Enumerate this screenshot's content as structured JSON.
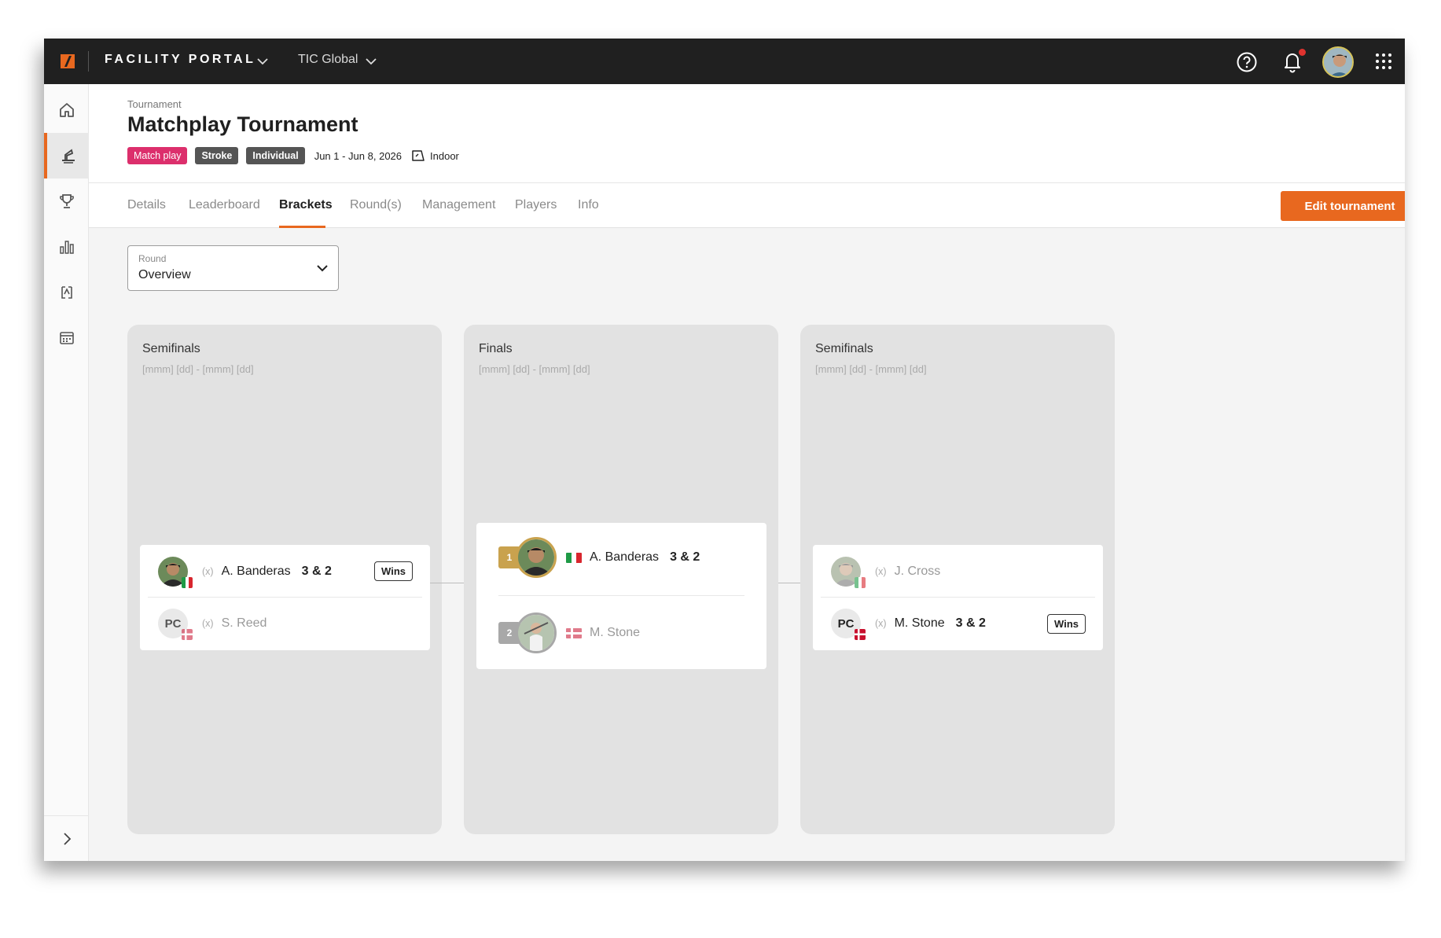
{
  "topbar": {
    "portal": "FACILITY PORTAL",
    "org": "TIC Global"
  },
  "page": {
    "crumb": "Tournament",
    "title": "Matchplay Tournament",
    "tags": [
      "Match play",
      "Stroke",
      "Individual"
    ],
    "dates": "Jun 1 - Jun 8, 2026",
    "location": "Indoor"
  },
  "tabs": [
    "Details",
    "Leaderboard",
    "Brackets",
    "Round(s)",
    "Management",
    "Players",
    "Info"
  ],
  "active_tab": "Brackets",
  "edit_button": "Edit tournament",
  "round_select": {
    "label": "Round",
    "value": "Overview"
  },
  "columns": [
    {
      "title": "Semifinals",
      "dates": "[mmm] [dd] - [mmm] [dd]",
      "match": [
        {
          "seed": "(x)",
          "name": "A. Banderas",
          "score": "3 & 2",
          "result": "Wins"
        },
        {
          "initials": "PC",
          "seed": "(x)",
          "name": "S. Reed"
        }
      ]
    },
    {
      "title": "Finals",
      "dates": "[mmm] [dd] - [mmm] [dd]",
      "match": [
        {
          "place": "1",
          "name": "A. Banderas",
          "score": "3 & 2"
        },
        {
          "place": "2",
          "name": "M. Stone"
        }
      ]
    },
    {
      "title": "Semifinals",
      "dates": "[mmm] [dd] - [mmm] [dd]",
      "match": [
        {
          "seed": "(x)",
          "name": "J. Cross"
        },
        {
          "initials": "PC",
          "seed": "(x)",
          "name": "M. Stone",
          "score": "3 & 2",
          "result": "Wins"
        }
      ]
    }
  ],
  "colors": {
    "accent": "#e8681f",
    "tag_pink": "#dc2f6c",
    "tag_gray": "#555555",
    "gold": "#c9a24e",
    "silver": "#a8a8a8"
  },
  "icons": {
    "sidebar": [
      "home-icon",
      "golf-tee-icon",
      "trophy-icon",
      "bar-chart-icon",
      "activity-icon",
      "calendar-icon"
    ],
    "expand": "chevron-right-icon"
  }
}
